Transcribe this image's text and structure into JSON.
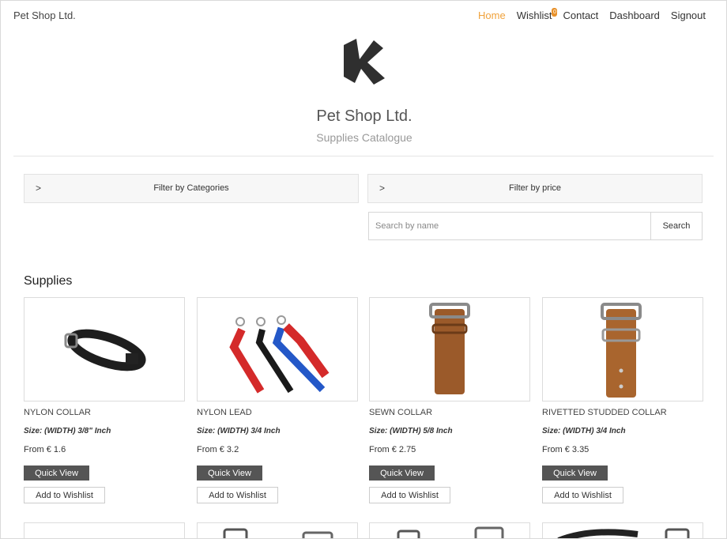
{
  "header": {
    "brand": "Pet Shop Ltd.",
    "nav": [
      {
        "label": "Home",
        "active": true
      },
      {
        "label": "Wishlist",
        "badge": "0"
      },
      {
        "label": "Contact"
      },
      {
        "label": "Dashboard"
      },
      {
        "label": "Signout"
      }
    ],
    "logo_icon": "k-logo-icon",
    "title": "Pet Shop Ltd.",
    "subtitle": "Supplies Catalogue"
  },
  "filters": {
    "categories_label": "Filter by Categories",
    "price_label": "Filter by price",
    "chevron": ">"
  },
  "search": {
    "placeholder": "Search by name",
    "value": "",
    "button_label": "Search"
  },
  "section": {
    "title": "Supplies"
  },
  "products": [
    {
      "name": "NYLON COLLAR",
      "size": "Size: (WIDTH) 3/8\" Inch",
      "price": "From € 1.6",
      "quick_view": "Quick View",
      "wishlist": "Add to Wishlist"
    },
    {
      "name": "NYLON LEAD",
      "size": "Size: (WIDTH) 3/4 Inch",
      "price": "From € 3.2",
      "quick_view": "Quick View",
      "wishlist": "Add to Wishlist"
    },
    {
      "name": "SEWN COLLAR",
      "size": "Size: (WIDTH) 5/8 Inch",
      "price": "From € 2.75",
      "quick_view": "Quick View",
      "wishlist": "Add to Wishlist"
    },
    {
      "name": "RIVETTED STUDDED COLLAR",
      "size": "Size: (WIDTH) 3/4 Inch",
      "price": "From € 3.35",
      "quick_view": "Quick View",
      "wishlist": "Add to Wishlist"
    }
  ],
  "colors": {
    "accent": "#f0a23b",
    "button_dark": "#555555",
    "badge": "#e8912a"
  }
}
